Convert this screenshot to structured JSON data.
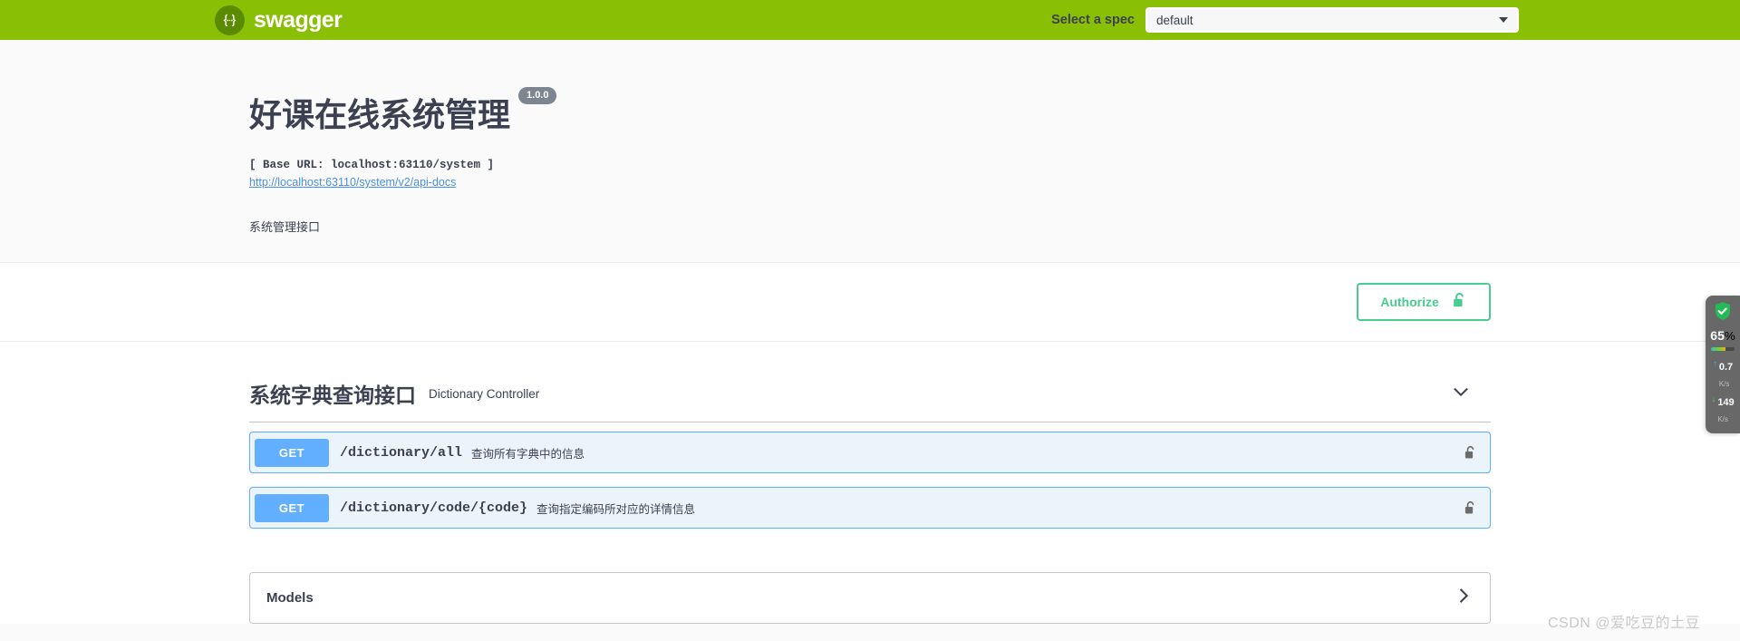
{
  "topbar": {
    "logo_text": "swagger",
    "logo_icon": "swagger-braces-icon",
    "spec_label": "Select a spec",
    "spec_selected": "default",
    "spec_options": [
      "default"
    ]
  },
  "info": {
    "title": "好课在线系统管理",
    "version": "1.0.0",
    "base_url": "[ Base URL: localhost:63110/system ]",
    "api_docs_link": "http://localhost:63110/system/v2/api-docs",
    "description": "系统管理接口"
  },
  "auth": {
    "authorize_label": "Authorize",
    "lock_icon": "unlocked-padlock-icon",
    "accent_color": "#49cc90"
  },
  "tag_section": {
    "title": "系统字典查询接口",
    "description": "Dictionary Controller",
    "chevron_icon": "chevron-down-icon",
    "expanded": true
  },
  "operations": [
    {
      "method": "GET",
      "path": "/dictionary/all",
      "summary": "查询所有字典中的信息",
      "lock_icon": "unlocked-padlock-icon",
      "method_color": "#61affe"
    },
    {
      "method": "GET",
      "path": "/dictionary/code/{code}",
      "summary": "查询指定编码所对应的详情信息",
      "lock_icon": "unlocked-padlock-icon",
      "method_color": "#61affe"
    }
  ],
  "models": {
    "title": "Models",
    "chevron_icon": "chevron-right-icon",
    "expanded": false
  },
  "net_widget": {
    "shield_icon": "shield-check-icon",
    "percent": "65",
    "percent_unit": "%",
    "upload_value": "0.7",
    "upload_unit": "K/s",
    "download_value": "149",
    "download_unit": "K/s",
    "up_arrow_icon": "arrow-up-icon",
    "down_arrow_icon": "arrow-down-icon"
  },
  "watermark": "CSDN @爱吃豆的土豆"
}
